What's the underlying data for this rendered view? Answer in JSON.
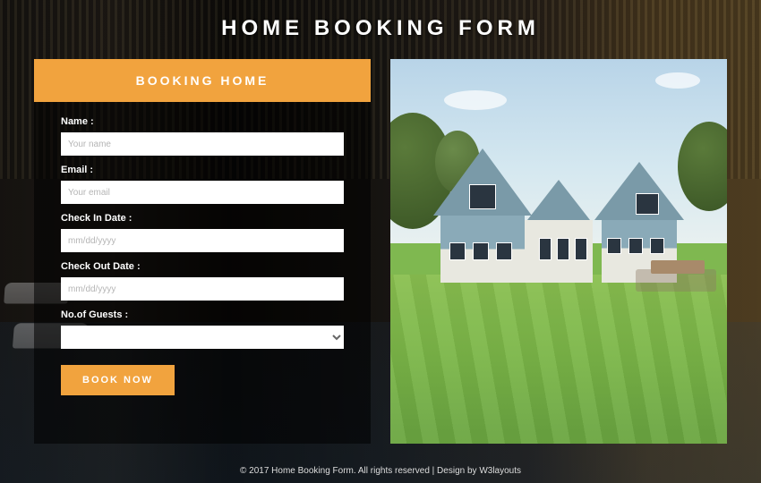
{
  "title": "HOME BOOKING FORM",
  "banner": "BOOKING HOME",
  "form": {
    "name_label": "Name :",
    "name_placeholder": "Your name",
    "email_label": "Email :",
    "email_placeholder": "Your email",
    "checkin_label": "Check In Date :",
    "checkin_placeholder": "mm/dd/yyyy",
    "checkout_label": "Check Out Date :",
    "checkout_placeholder": "mm/dd/yyyy",
    "guests_label": "No.of Guests :",
    "submit_label": "BOOK NOW"
  },
  "footer": {
    "text": "© 2017 Home Booking Form. All rights reserved | Design by ",
    "link": "W3layouts"
  },
  "colors": {
    "accent": "#f1a33e"
  }
}
